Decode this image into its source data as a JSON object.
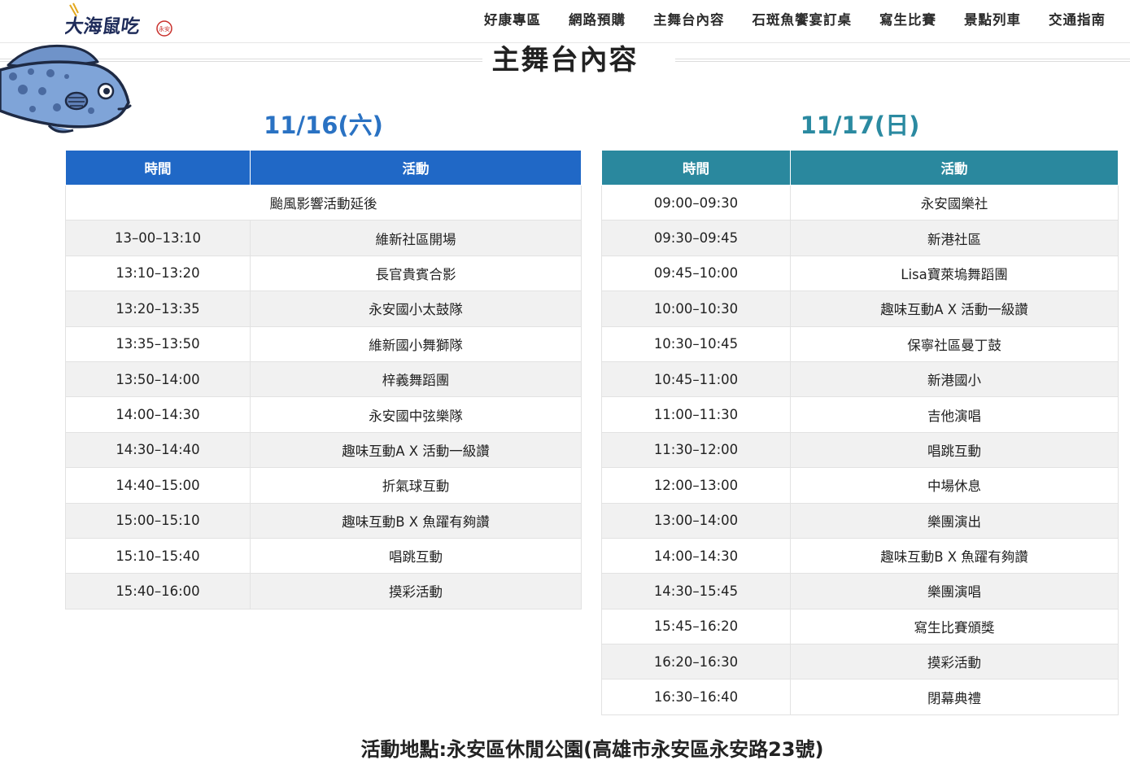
{
  "header": {
    "logo_text": "大海鼠吃",
    "logo_seal": "永安",
    "nav": [
      "好康專區",
      "網路預購",
      "主舞台內容",
      "石斑魚饗宴訂桌",
      "寫生比賽",
      "景點列車",
      "交通指南"
    ]
  },
  "section": {
    "title": "主舞台內容"
  },
  "saturday": {
    "date": "11/16(六)",
    "col_time": "時間",
    "col_activity": "活動",
    "notice": "颱風影響活動延後",
    "rows": [
      {
        "time": "13–00–13:10",
        "activity": "維新社區開場"
      },
      {
        "time": "13:10–13:20",
        "activity": "長官貴賓合影"
      },
      {
        "time": "13:20–13:35",
        "activity": "永安國小太鼓隊"
      },
      {
        "time": "13:35–13:50",
        "activity": "維新國小舞獅隊"
      },
      {
        "time": "13:50–14:00",
        "activity": "梓義舞蹈團"
      },
      {
        "time": "14:00–14:30",
        "activity": "永安國中弦樂隊"
      },
      {
        "time": "14:30–14:40",
        "activity": "趣味互動A X 活動一級讚"
      },
      {
        "time": "14:40–15:00",
        "activity": "折氣球互動"
      },
      {
        "time": "15:00–15:10",
        "activity": "趣味互動B X 魚躍有夠讚"
      },
      {
        "time": "15:10–15:40",
        "activity": "唱跳互動"
      },
      {
        "time": "15:40–16:00",
        "activity": "摸彩活動"
      }
    ]
  },
  "sunday": {
    "date": "11/17(日)",
    "col_time": "時間",
    "col_activity": "活動",
    "rows": [
      {
        "time": "09:00–09:30",
        "activity": "永安國樂社"
      },
      {
        "time": "09:30–09:45",
        "activity": "新港社區"
      },
      {
        "time": "09:45–10:00",
        "activity": "Lisa寶萊塢舞蹈團"
      },
      {
        "time": "10:00–10:30",
        "activity": "趣味互動A X 活動一級讚"
      },
      {
        "time": "10:30–10:45",
        "activity": "保寧社區曼丁鼓"
      },
      {
        "time": "10:45–11:00",
        "activity": "新港國小"
      },
      {
        "time": "11:00–11:30",
        "activity": "吉他演唱"
      },
      {
        "time": "11:30–12:00",
        "activity": "唱跳互動"
      },
      {
        "time": "12:00–13:00",
        "activity": "中場休息"
      },
      {
        "time": "13:00–14:00",
        "activity": "樂團演出"
      },
      {
        "time": "14:00–14:30",
        "activity": "趣味互動B X 魚躍有夠讚"
      },
      {
        "time": "14:30–15:45",
        "activity": "樂團演唱"
      },
      {
        "time": "15:45–16:20",
        "activity": "寫生比賽頒獎"
      },
      {
        "time": "16:20–16:30",
        "activity": "摸彩活動"
      },
      {
        "time": "16:30–16:40",
        "activity": "閉幕典禮"
      }
    ]
  },
  "location": "活動地點:永安區休閒公園(高雄市永安區永安路23號)",
  "colors": {
    "sat_header": "#2068c6",
    "sat_date": "#2a72c3",
    "sun_header": "#2a889e",
    "sun_date": "#2b8aa1",
    "fish_body": "#7fa4d8",
    "fish_outline": "#1e2a44"
  }
}
